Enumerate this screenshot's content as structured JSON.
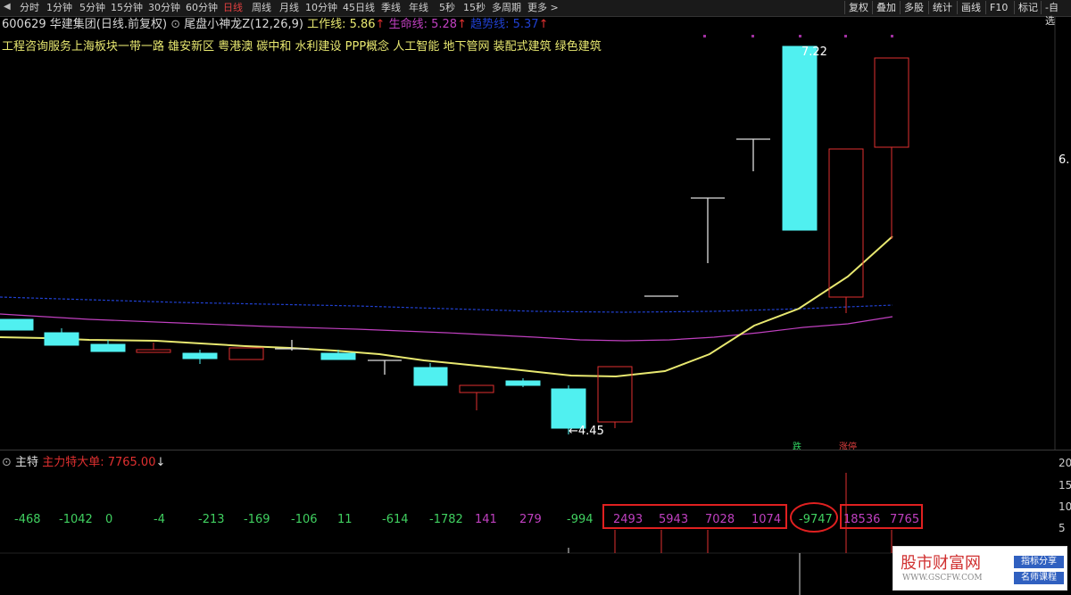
{
  "toolbar": {
    "tabs": [
      "分时",
      "1分钟",
      "5分钟",
      "15分钟",
      "30分钟",
      "60分钟",
      "日线",
      "周线",
      "月线",
      "10分钟",
      "45日线",
      "季线",
      "年线",
      "5秒",
      "15秒",
      "多周期",
      "更多 >"
    ],
    "active_tab": "日线",
    "right_buttons": [
      "复权",
      "叠加",
      "多股",
      "统计",
      "画线",
      "F10",
      "标记",
      "-自选"
    ]
  },
  "header": {
    "code": "600629",
    "name": "华建集团",
    "period": "(日线.前复权)",
    "indicator": "尾盘小神龙Z(12,26,9)",
    "work_line": "工作线: 5.86",
    "work_arrow": "↑",
    "life_line": "生命线: 5.28",
    "life_arrow": "↑",
    "trend_line": "趋势线: 5.37",
    "trend_arrow": "↑"
  },
  "concepts": "工程咨询服务上海板块一带一路 雄安新区 粤港澳 碳中和 水利建设 PPP概念 人工智能 地下管网 装配式建筑 绿色建筑",
  "price_labels": {
    "high": "7.22",
    "low": "←4.45",
    "right_axis": "6."
  },
  "signals": {
    "die": "跌",
    "zhangting": "涨停"
  },
  "sub_panel": {
    "name": "主特",
    "indicator": "主力特大单: 7765.00",
    "indicator_arrow": "↓",
    "values": [
      "-468",
      "-1042",
      "0",
      "-4",
      "-213",
      "-169",
      "-106",
      "11",
      "-614",
      "-1782",
      "141",
      "279",
      "-994",
      "2493",
      "5943",
      "7028",
      "1074",
      "-9747",
      "18536",
      "7765"
    ],
    "y_ticks": [
      "20",
      "15",
      "10",
      "5"
    ]
  },
  "colors": {
    "up": "#e03030",
    "down": "#50f0f0",
    "work": "#e8e870",
    "life": "#c040c0",
    "trend": "#2040d0",
    "positive": "#c040c0",
    "negative": "#40d060"
  },
  "watermark": {
    "title": "股市财富网",
    "url": "WWW.GSCFW.COM",
    "tag1": "指标分享",
    "tag2": "名师课程"
  }
}
